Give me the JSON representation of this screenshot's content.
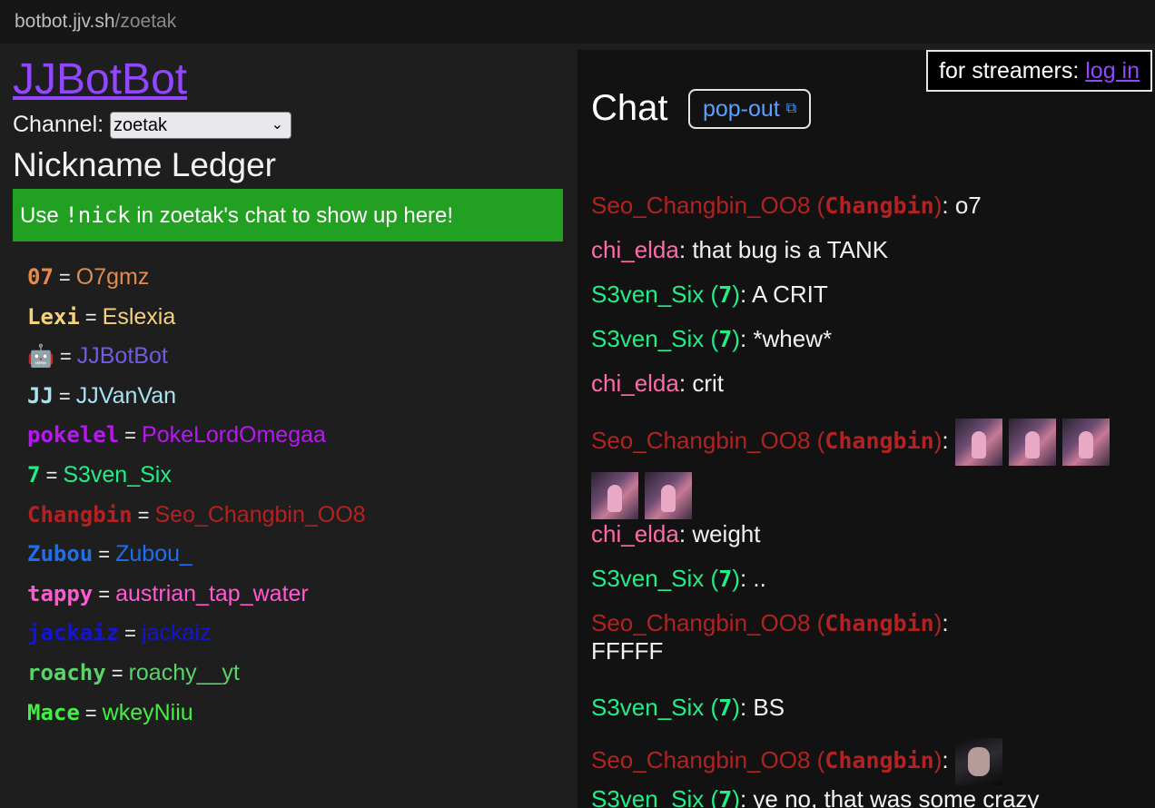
{
  "browser": {
    "url_host": "botbot.jjv.sh",
    "url_path": "/zoetak"
  },
  "site_title": "JJBotBot",
  "channel": {
    "label": "Channel:",
    "selected": "zoetak"
  },
  "ledger": {
    "heading": "Nickname Ledger",
    "banner_pre": "Use ",
    "banner_cmd": "!nick",
    "banner_post": " in zoetak's chat to show up here!",
    "entries": [
      {
        "nick": "07",
        "user": "O7gmz",
        "color": "#e28b4f"
      },
      {
        "nick": "Lexi",
        "user": "Eslexia",
        "color": "#f5d37c"
      },
      {
        "nick": "🤖",
        "user": "JJBotBot",
        "color": "#6f5de0"
      },
      {
        "nick": "JJ",
        "user": "JJVanVan",
        "color": "#a8e3f0"
      },
      {
        "nick": "pokelel",
        "user": "PokeLordOmegaa",
        "color": "#b619f0"
      },
      {
        "nick": "7",
        "user": "S3ven_Six",
        "color": "#22ee88"
      },
      {
        "nick": "Changbin",
        "user": "Seo_Changbin_OO8",
        "color": "#b22222"
      },
      {
        "nick": "Zubou",
        "user": "Zubou_",
        "color": "#1e6ff0"
      },
      {
        "nick": "tappy",
        "user": "austrian_tap_water",
        "color": "#ff5ad2"
      },
      {
        "nick": "jackaiz",
        "user": "jackaiz",
        "color": "#1414d2"
      },
      {
        "nick": "roachy",
        "user": "roachy__yt",
        "color": "#5bd36a"
      },
      {
        "nick": "Mace",
        "user": "wkeyNiiu",
        "color": "#44ee44"
      }
    ]
  },
  "chat": {
    "title": "Chat",
    "popout_label": "pop-out",
    "popout_icon": "external-link-icon",
    "streamer_prefix": "for streamers: ",
    "login_label": "log in",
    "messages": [
      {
        "author": "Seo_Changbin_OO8",
        "alias": "Changbin",
        "text": "o7",
        "color": "#b22222",
        "cut": true
      },
      {
        "author": "chi_elda",
        "alias": "",
        "text": "that bug is a TANK",
        "color": "#ff6aa8"
      },
      {
        "author": "S3ven_Six",
        "alias": "7",
        "text": "A CRIT",
        "color": "#22ee88"
      },
      {
        "author": "S3ven_Six",
        "alias": "7",
        "text": "*whew*",
        "color": "#22ee88"
      },
      {
        "author": "chi_elda",
        "alias": "",
        "text": "crit",
        "color": "#ff6aa8"
      },
      {
        "author": "Seo_Changbin_OO8",
        "alias": "Changbin",
        "text": "",
        "color": "#b22222",
        "emotes": 5,
        "emote_style": "pink"
      },
      {
        "author": "chi_elda",
        "alias": "",
        "text": "weight",
        "color": "#ff6aa8"
      },
      {
        "author": "S3ven_Six",
        "alias": "7",
        "text": "..",
        "color": "#22ee88"
      },
      {
        "author": "Seo_Changbin_OO8",
        "alias": "Changbin",
        "text": "FFFFF",
        "color": "#b22222",
        "wrap": true
      },
      {
        "author": "S3ven_Six",
        "alias": "7",
        "text": "BS",
        "color": "#22ee88"
      },
      {
        "author": "Seo_Changbin_OO8",
        "alias": "Changbin",
        "text": "",
        "color": "#b22222",
        "emotes": 1,
        "emote_style": "dark"
      },
      {
        "author": "S3ven_Six",
        "alias": "7",
        "text": "ye no, that was some crazy nonsense",
        "color": "#22ee88"
      }
    ]
  }
}
